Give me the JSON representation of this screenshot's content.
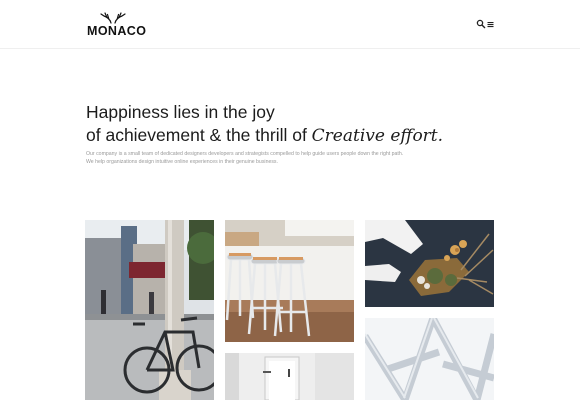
{
  "header": {
    "logo_text": "MONACO",
    "icons": [
      "antlers-logo-icon",
      "search-icon",
      "menu-icon"
    ]
  },
  "hero": {
    "title_line1": "Happiness lies in the joy",
    "title_line2_prefix": "of achievement & the thrill of ",
    "title_line2_emphasis": "Creative effort.",
    "description_line1": "Our company is a small team of dedicated designers developers and strategists compelled to help guide users people down the right path.",
    "description_line2": "We help organizations design intuitive online experiences in their genuine business."
  },
  "gallery": {
    "items": [
      {
        "subject": "street-bicycle-photo"
      },
      {
        "subject": "bar-stools-photo"
      },
      {
        "subject": "interior-door-photo"
      },
      {
        "subject": "dried-flowers-photo"
      },
      {
        "subject": "white-structure-photo"
      }
    ]
  },
  "colors": {
    "text": "#1c1c1c",
    "muted": "#9a9a9a",
    "divider": "#efefef",
    "background": "#ffffff"
  }
}
